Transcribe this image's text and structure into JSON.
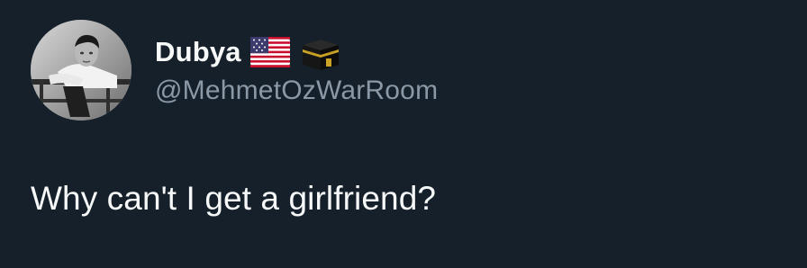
{
  "author": {
    "display_name": "Dubya",
    "handle": "@MehmetOzWarRoom",
    "avatar": "profile-photo-grayscale-man-leaning-on-railing",
    "name_emojis": [
      "us-flag-icon",
      "kaaba-icon"
    ]
  },
  "tweet": {
    "text": "Why can't I get a girlfriend?"
  },
  "colors": {
    "background": "#15202b",
    "primary_text": "#f7f9f9",
    "secondary_text": "#8b98a5"
  }
}
